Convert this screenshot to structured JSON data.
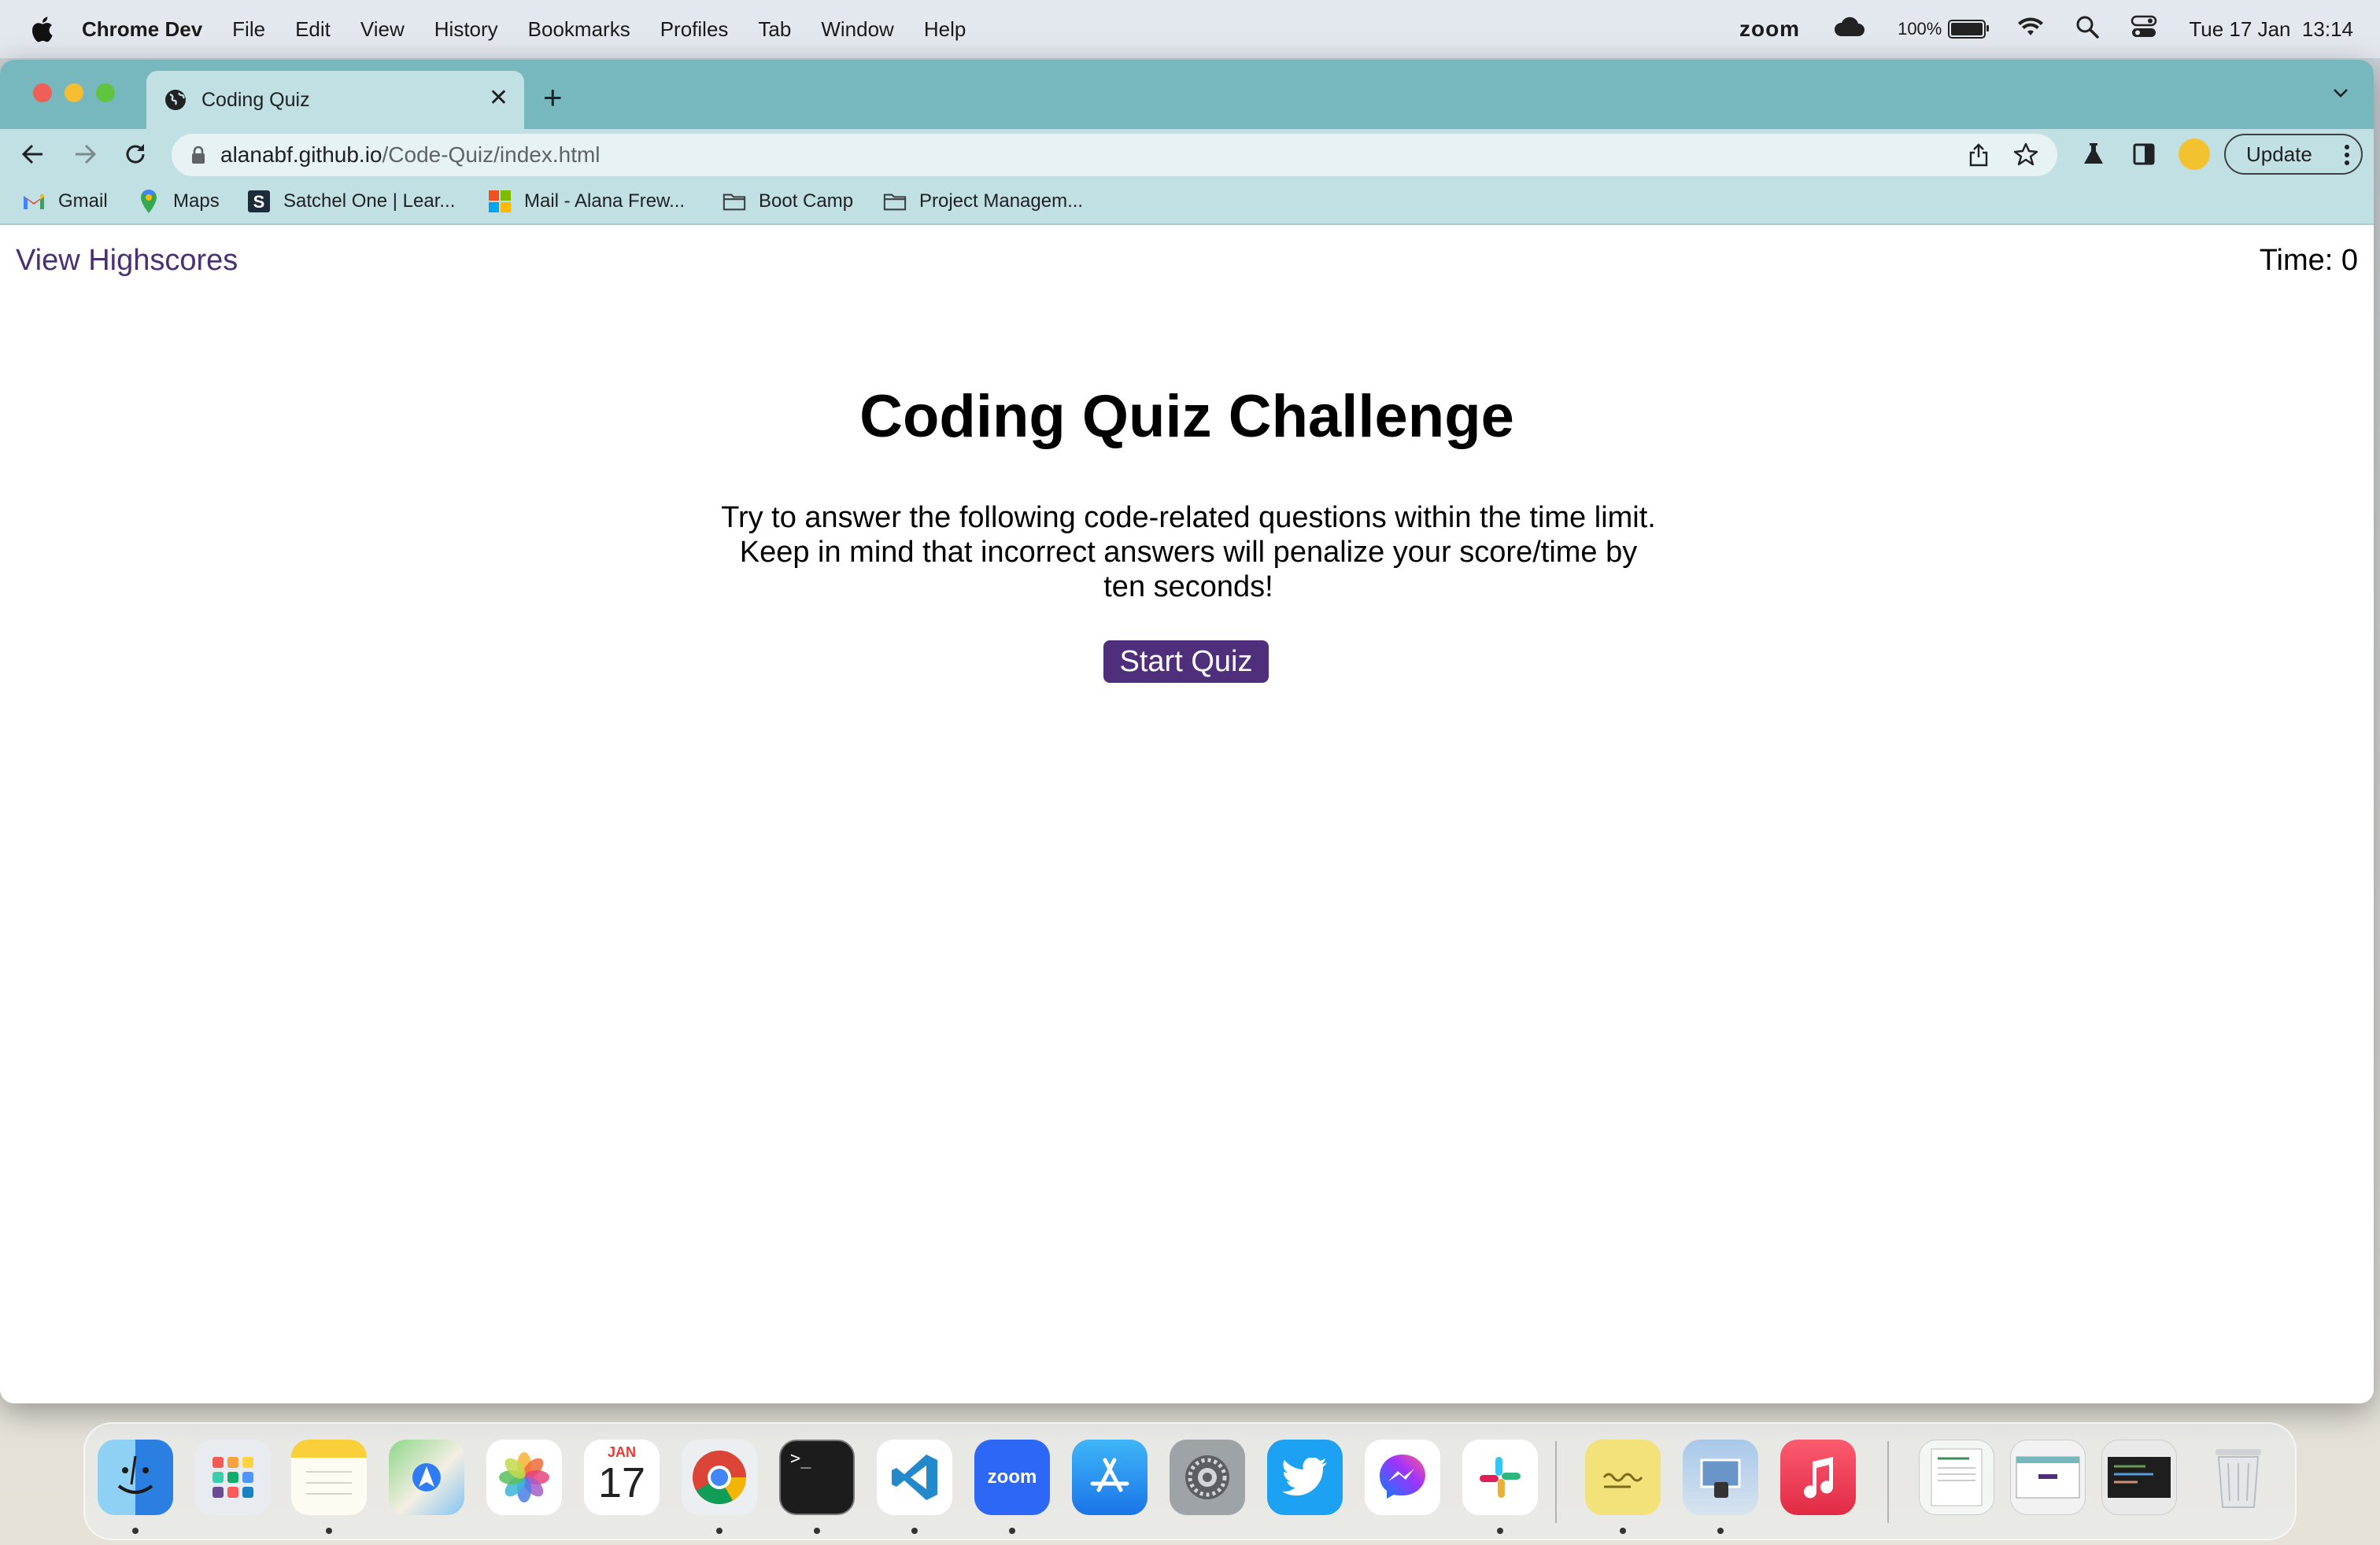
{
  "menubar": {
    "app_name": "Chrome Dev",
    "menus": [
      "File",
      "Edit",
      "View",
      "History",
      "Bookmarks",
      "Profiles",
      "Tab",
      "Window",
      "Help"
    ],
    "zoom_label": "zoom",
    "battery_label": "100%",
    "battery_level": 1.0,
    "datetime": "Tue 17 Jan  13:14"
  },
  "tab": {
    "title": "Coding Quiz"
  },
  "toolbar": {
    "url_host": "alanabf.github.io",
    "url_path": "/Code-Quiz/index.html",
    "update_label": "Update"
  },
  "bookmarks": [
    {
      "label": "Gmail",
      "icon": "gmail-icon"
    },
    {
      "label": "Maps",
      "icon": "maps-icon"
    },
    {
      "label": "Satchel One | Lear...",
      "icon": "satchel-icon"
    },
    {
      "label": "Mail - Alana Frew...",
      "icon": "microsoft-icon"
    },
    {
      "label": "Boot Camp",
      "icon": "folder-icon"
    },
    {
      "label": "Project Managem...",
      "icon": "folder-icon"
    }
  ],
  "page": {
    "highscores_link": "View Highscores",
    "timer": "Time: 0",
    "title": "Coding Quiz Challenge",
    "instructions": "Try to answer the following code-related questions within the time limit. Keep in mind that incorrect answers will penalize your score/time by ten seconds!",
    "start_button": "Start Quiz"
  },
  "dock": {
    "calendar_month": "JAN",
    "calendar_day": "17",
    "zoom_app_label": "zoom",
    "terminal_prompt": ">_"
  },
  "colors": {
    "accent": "#4f2f7c",
    "link": "#4b2f74",
    "tabstrip": "#76b8be",
    "toolbar": "#c1e0e3"
  }
}
